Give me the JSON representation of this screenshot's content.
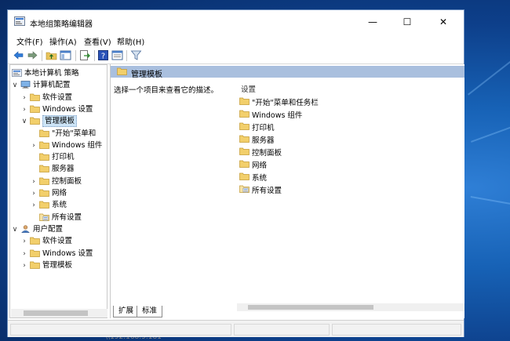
{
  "window": {
    "title": "本地组策略编辑器",
    "minimize": "—",
    "maximize": "☐",
    "close": "✕"
  },
  "menu": [
    "文件(F)",
    "操作(A)",
    "查看(V)",
    "帮助(H)"
  ],
  "tree": [
    {
      "label": "本地计算机 策略",
      "level": 0,
      "toggle": "",
      "icon": "computer-policy-icon"
    },
    {
      "label": "计算机配置",
      "level": 1,
      "toggle": "∨",
      "icon": "computer-icon"
    },
    {
      "label": "软件设置",
      "level": 2,
      "toggle": "›",
      "icon": "folder-icon"
    },
    {
      "label": "Windows 设置",
      "level": 2,
      "toggle": "›",
      "icon": "folder-icon"
    },
    {
      "label": "管理模板",
      "level": 2,
      "toggle": "∨",
      "icon": "folder-icon",
      "selected": true
    },
    {
      "label": "\"开始\"菜单和",
      "level": 3,
      "toggle": "",
      "icon": "folder-icon"
    },
    {
      "label": "Windows 组件",
      "level": 3,
      "toggle": "›",
      "icon": "folder-icon"
    },
    {
      "label": "打印机",
      "level": 3,
      "toggle": "",
      "icon": "folder-icon"
    },
    {
      "label": "服务器",
      "level": 3,
      "toggle": "",
      "icon": "folder-icon"
    },
    {
      "label": "控制面板",
      "level": 3,
      "toggle": "›",
      "icon": "folder-icon"
    },
    {
      "label": "网络",
      "level": 3,
      "toggle": "›",
      "icon": "folder-icon"
    },
    {
      "label": "系统",
      "level": 3,
      "toggle": "›",
      "icon": "folder-icon"
    },
    {
      "label": "所有设置",
      "level": 3,
      "toggle": "",
      "icon": "all-settings-icon"
    },
    {
      "label": "用户配置",
      "level": 1,
      "toggle": "∨",
      "icon": "user-icon"
    },
    {
      "label": "软件设置",
      "level": 2,
      "toggle": "›",
      "icon": "folder-icon"
    },
    {
      "label": "Windows 设置",
      "level": 2,
      "toggle": "›",
      "icon": "folder-icon"
    },
    {
      "label": "管理模板",
      "level": 2,
      "toggle": "›",
      "icon": "folder-icon"
    }
  ],
  "right": {
    "header": "管理模板",
    "description": "选择一个项目来查看它的描述。",
    "column": "设置",
    "items": [
      {
        "label": "\"开始\"菜单和任务栏",
        "icon": "folder-icon"
      },
      {
        "label": "Windows 组件",
        "icon": "folder-icon"
      },
      {
        "label": "打印机",
        "icon": "folder-icon"
      },
      {
        "label": "服务器",
        "icon": "folder-icon"
      },
      {
        "label": "控制面板",
        "icon": "folder-icon"
      },
      {
        "label": "网络",
        "icon": "folder-icon"
      },
      {
        "label": "系统",
        "icon": "folder-icon"
      },
      {
        "label": "所有设置",
        "icon": "all-settings-icon"
      }
    ]
  },
  "tabs": [
    "扩展",
    "标准"
  ],
  "below_text": "\\\\192.168.9.181"
}
